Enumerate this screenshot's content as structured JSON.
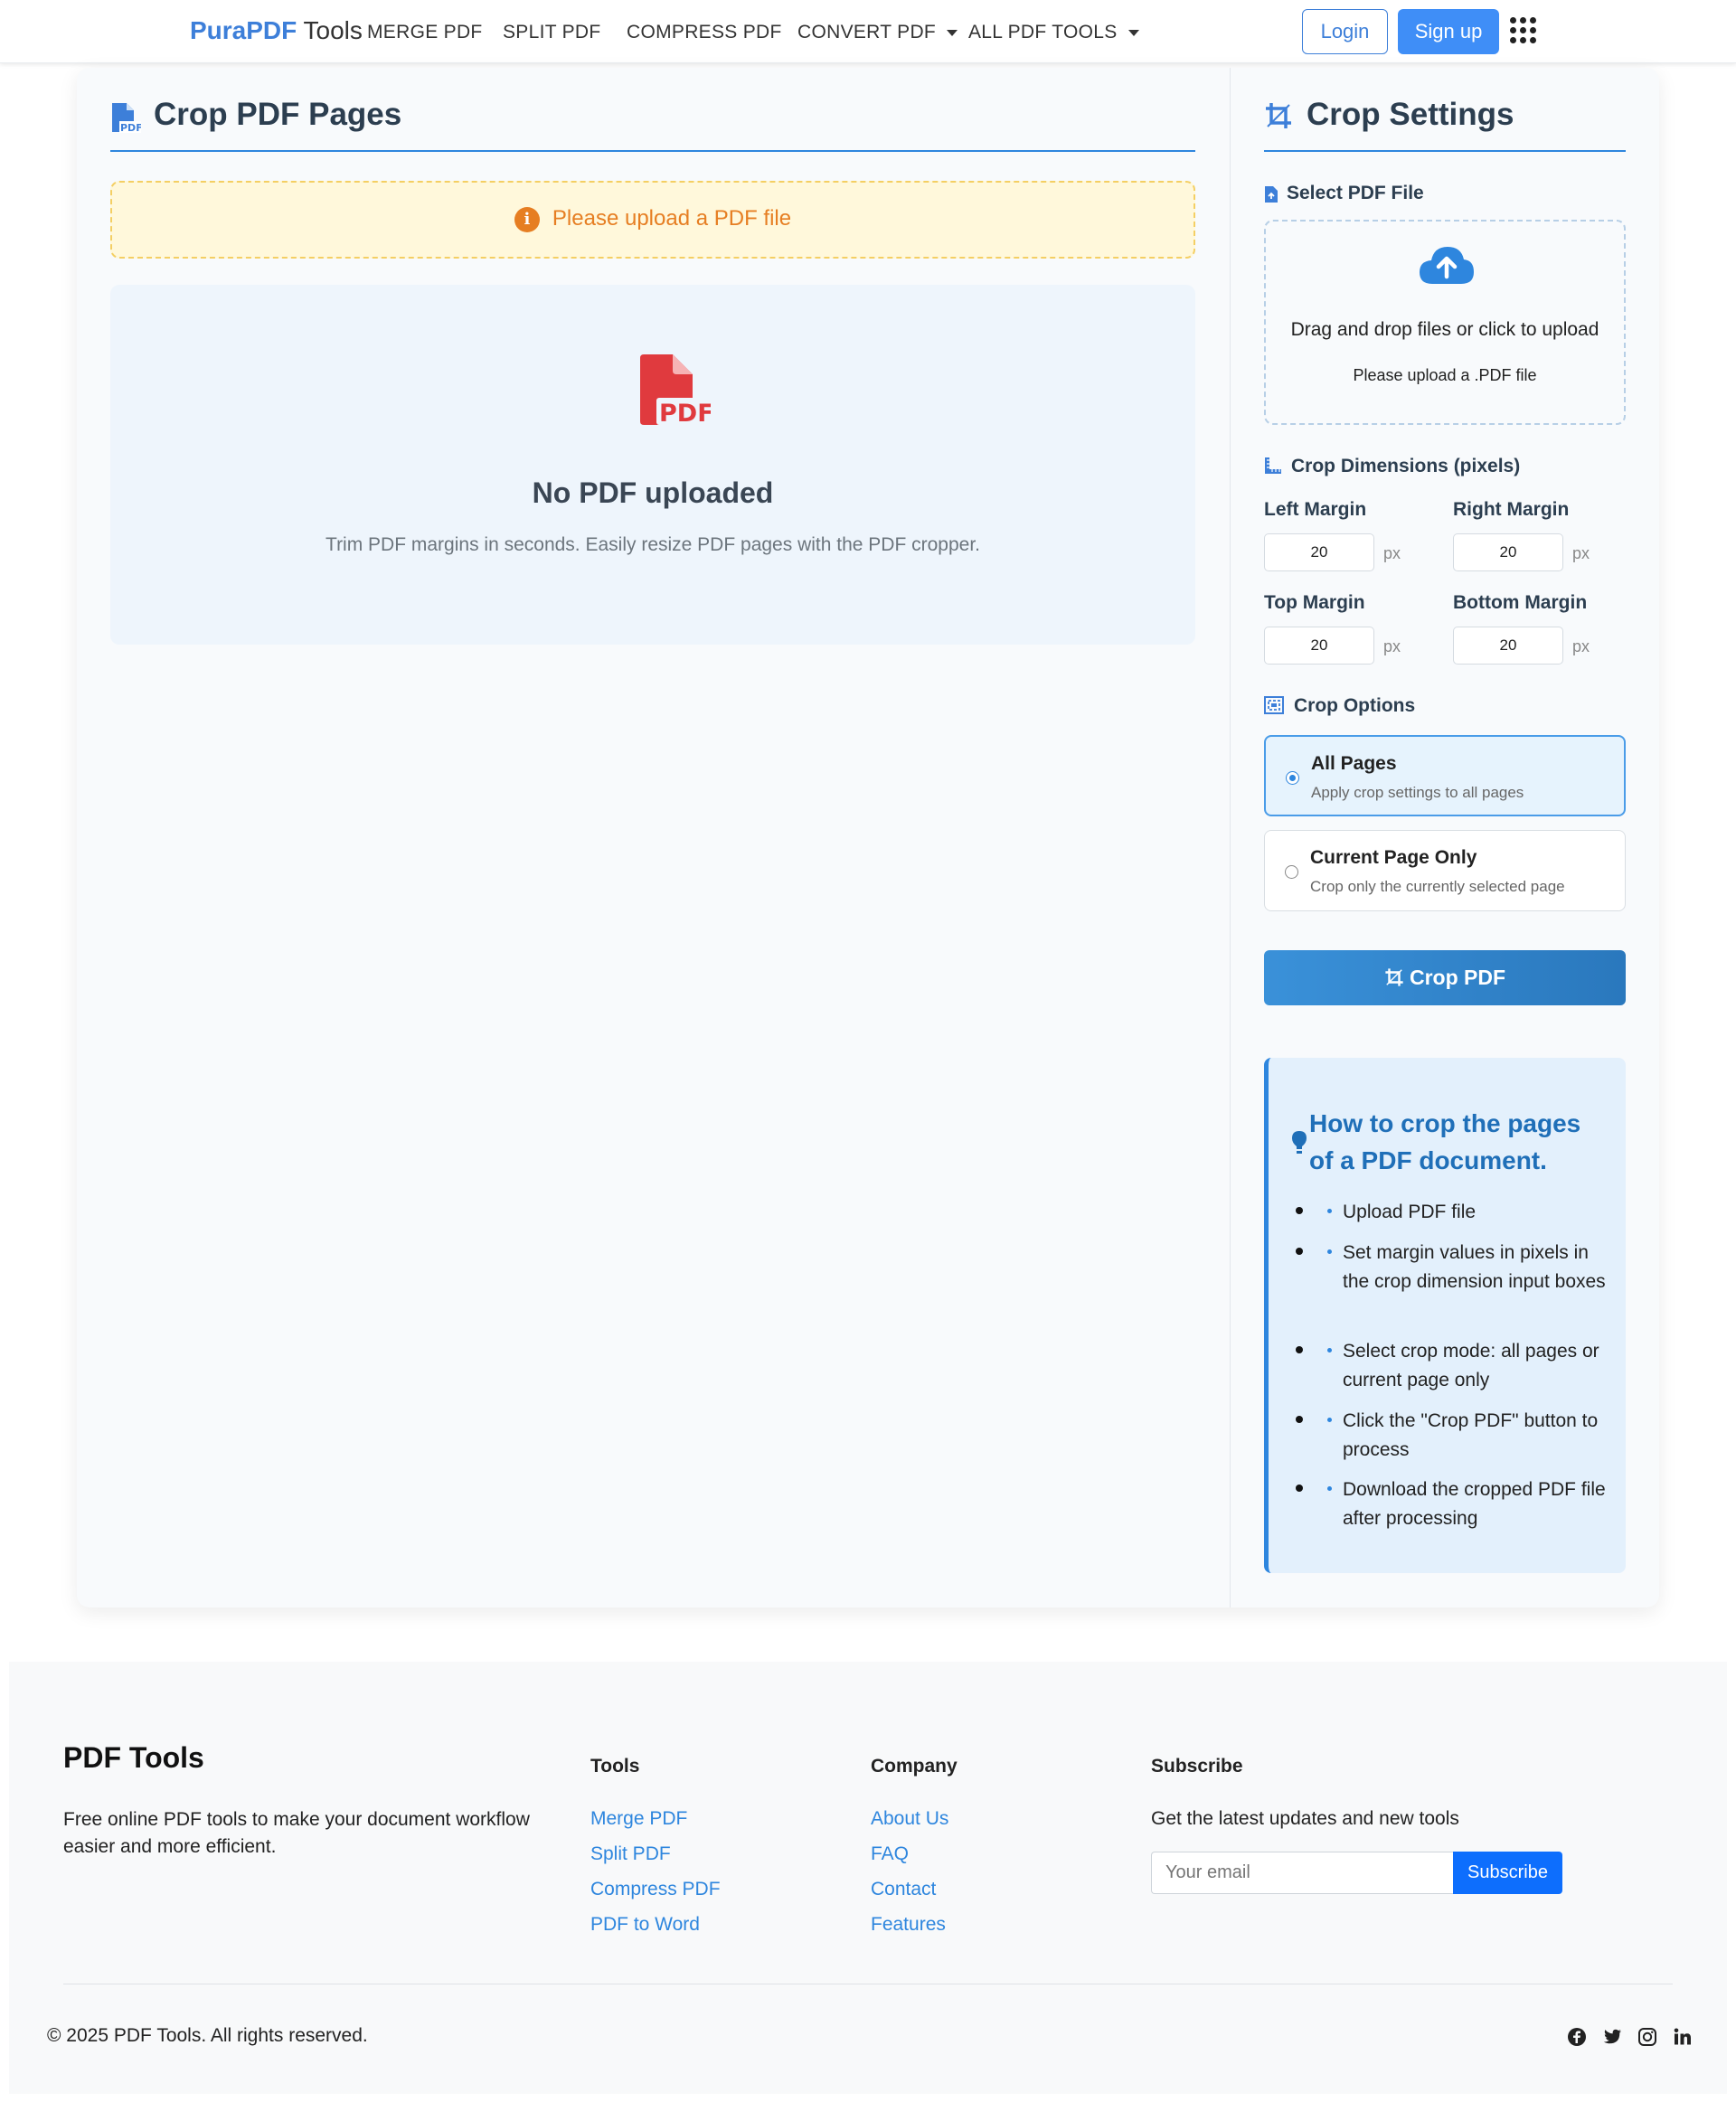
{
  "navbar": {
    "brand_primary": "PuraPDF",
    "brand_secondary": "Tools",
    "links": [
      "MERGE PDF",
      "SPLIT PDF",
      "COMPRESS PDF",
      "CONVERT PDF",
      "ALL PDF TOOLS"
    ],
    "login_label": "Login",
    "signup_label": "Sign up"
  },
  "main": {
    "title": "Crop PDF Pages",
    "alert_text": "Please upload a PDF file",
    "empty_title": "No PDF uploaded",
    "empty_subtitle": "Trim PDF margins in seconds. Easily resize PDF pages with the PDF cropper.",
    "pdf_icon_label": "PDF",
    "pdf_badge": "PDF"
  },
  "settings": {
    "title": "Crop Settings",
    "select_file_label": "Select PDF File",
    "upload_main": "Drag and drop files or click to upload",
    "upload_sub": "Please upload a .PDF file",
    "dimensions_label": "Crop Dimensions (pixels)",
    "margins": {
      "left_label": "Left Margin",
      "left_value": "20",
      "right_label": "Right Margin",
      "right_value": "20",
      "top_label": "Top Margin",
      "top_value": "20",
      "bottom_label": "Bottom Margin",
      "bottom_value": "20",
      "unit": "px"
    },
    "options_label": "Crop Options",
    "options": [
      {
        "title": "All Pages",
        "desc": "Apply crop settings to all pages",
        "selected": true
      },
      {
        "title": "Current Page Only",
        "desc": "Crop only the currently selected page",
        "selected": false
      }
    ],
    "crop_button": "Crop PDF"
  },
  "howto": {
    "title": "How to crop the pages of a PDF document.",
    "steps": [
      "Upload PDF file",
      "Set margin values in pixels in the crop dimension input boxes",
      "Select crop mode: all pages or current page only",
      "Click the \"Crop PDF\" button to process",
      "Download the cropped PDF file after processing"
    ]
  },
  "footer": {
    "brand": "PDF Tools",
    "description": "Free online PDF tools to make your document workflow easier and more efficient.",
    "tools_head": "Tools",
    "tools_links": [
      "Merge PDF",
      "Split PDF",
      "Compress PDF",
      "PDF to Word"
    ],
    "company_head": "Company",
    "company_links": [
      "About Us",
      "FAQ",
      "Contact",
      "Features"
    ],
    "subscribe_head": "Subscribe",
    "subscribe_note": "Get the latest updates and new tools",
    "email_placeholder": "Your email",
    "subscribe_button": "Subscribe",
    "copyright": "© 2025 PDF Tools. All rights reserved."
  },
  "colors": {
    "brand": "#3d7fd9",
    "accent": "#2e86de",
    "warning": "#e67e22",
    "pdf_red": "#e03a3e"
  }
}
